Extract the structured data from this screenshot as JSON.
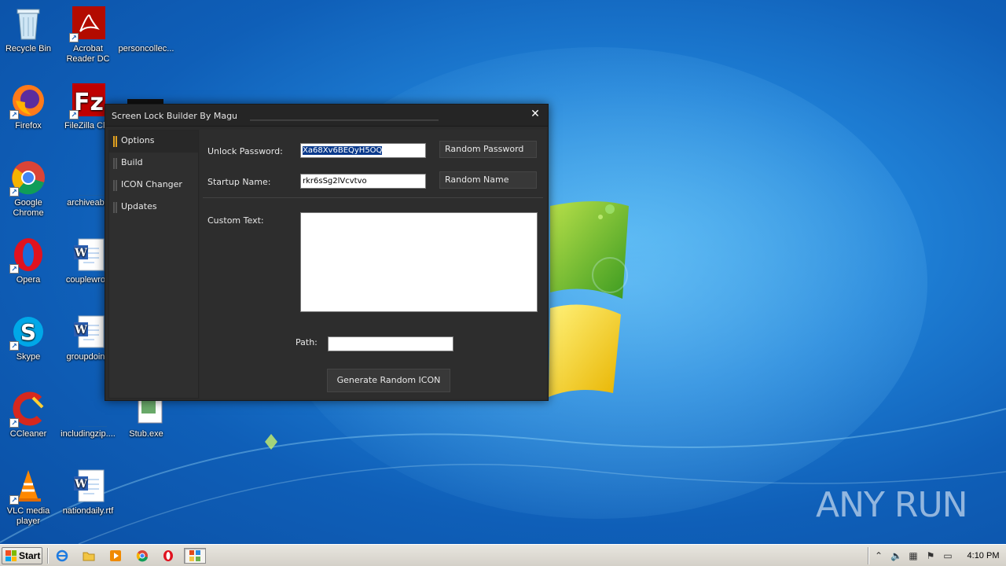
{
  "desktop": {
    "icons": [
      {
        "label": "Recycle Bin"
      },
      {
        "label": "Acrobat Reader DC"
      },
      {
        "label": "personcollec..."
      },
      {
        "label": "Firefox"
      },
      {
        "label": "FileZilla Clie"
      },
      {
        "label": "Google Chrome"
      },
      {
        "label": "archiveabo"
      },
      {
        "label": "Opera"
      },
      {
        "label": "couplewron"
      },
      {
        "label": "Skype"
      },
      {
        "label": "groupdoing"
      },
      {
        "label": "CCleaner"
      },
      {
        "label": "includingzip...."
      },
      {
        "label": "Stub.exe"
      },
      {
        "label": "VLC media player"
      },
      {
        "label": "nationdaily.rtf"
      }
    ],
    "watermark": "ANY RUN"
  },
  "window": {
    "title": "Screen Lock Builder By Magu",
    "close_glyph": "✕",
    "sidebar": {
      "items": [
        {
          "label": "Options",
          "active": true
        },
        {
          "label": "Build",
          "active": false
        },
        {
          "label": "ICON Changer",
          "active": false
        },
        {
          "label": "Updates",
          "active": false
        }
      ]
    },
    "options": {
      "unlock_password_label": "Unlock Password:",
      "unlock_password_value": "Xa68Xv6BEQyH5OQ",
      "random_password_button": "Random Password",
      "startup_name_label": "Startup Name:",
      "startup_name_value": "rkr6sSg2lVcvtvo",
      "random_name_button": "Random Name",
      "custom_text_label": "Custom Text:",
      "custom_text_value": "",
      "path_label": "Path:",
      "path_value": "",
      "generate_icon_button": "Generate Random ICON"
    }
  },
  "taskbar": {
    "start_label": "Start",
    "clock": "4:10 PM",
    "pinned": [
      "internet-explorer-icon",
      "explorer-folder-icon",
      "media-player-icon",
      "chrome-icon",
      "opera-icon",
      "screen-lock-builder-icon"
    ]
  },
  "colors": {
    "window_bg": "#2b2b2b",
    "accent_marker": "#e0a020",
    "selection": "#0a3a8c"
  }
}
